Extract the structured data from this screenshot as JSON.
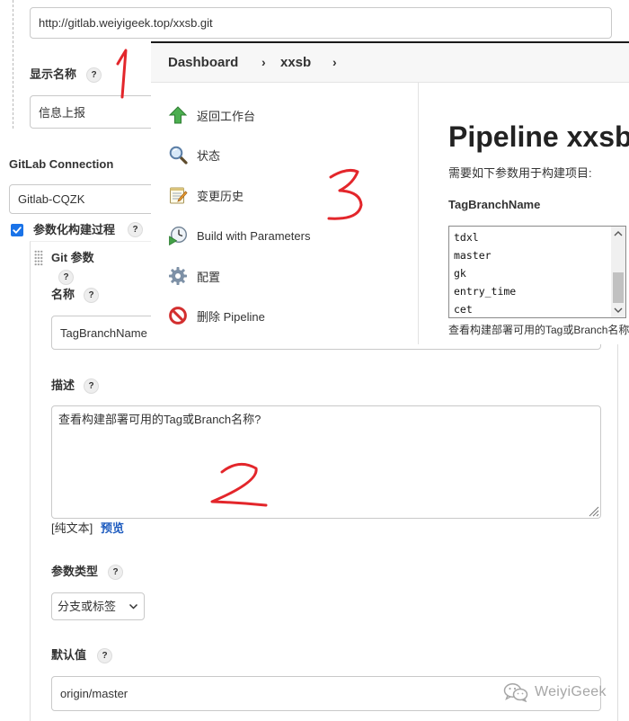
{
  "form": {
    "help": "?",
    "repo_url": {
      "value": "http://gitlab.weiyigeek.top/xxsb.git"
    },
    "display_name": {
      "label": "显示名称",
      "value": "信息上报"
    },
    "gitlab_connection": {
      "label": "GitLab Connection",
      "value": "Gitlab-CQZK"
    },
    "parameterized": {
      "label": "参数化构建过程",
      "checked": true
    },
    "git_param": {
      "title": "Git 参数",
      "name": {
        "label": "名称",
        "value": "TagBranchName"
      },
      "description": {
        "label": "描述",
        "value": "查看构建部署可用的Tag或Branch名称?"
      },
      "plain_text": "[纯文本]",
      "preview": "预览",
      "param_type": {
        "label": "参数类型",
        "value": "分支或标签"
      },
      "default_value": {
        "label": "默认值",
        "value": "origin/master"
      }
    }
  },
  "pipeline": {
    "breadcrumb": {
      "items": [
        "Dashboard",
        "xxsb"
      ],
      "separator": "›"
    },
    "sidebar": [
      {
        "label": "返回工作台",
        "icon": "up-arrow-icon"
      },
      {
        "label": "状态",
        "icon": "magnifier-icon"
      },
      {
        "label": "变更历史",
        "icon": "notepad-icon"
      },
      {
        "label": "Build with Parameters",
        "icon": "clock-play-icon"
      },
      {
        "label": "配置",
        "icon": "gear-icon"
      },
      {
        "label": "删除 Pipeline",
        "icon": "no-entry-icon"
      }
    ],
    "title": "Pipeline xxsb",
    "intro": "需要如下参数用于构建项目:",
    "param_name": "TagBranchName",
    "options": [
      "tdxl",
      "master",
      "gk",
      "entry_time",
      "cet"
    ],
    "param_description": "查看构建部署可用的Tag或Branch名称?"
  },
  "annotations": [
    {
      "label": "1"
    },
    {
      "label": "2"
    },
    {
      "label": "3"
    }
  ],
  "watermark": {
    "text": "WeiyiGeek",
    "icon": "wechat-icon"
  },
  "colors": {
    "annotation": "#e3262b",
    "link": "#1d5bbf",
    "checkbox": "#1a73e8",
    "up_arrow": "#4caf50",
    "delete": "#d32f2f"
  }
}
